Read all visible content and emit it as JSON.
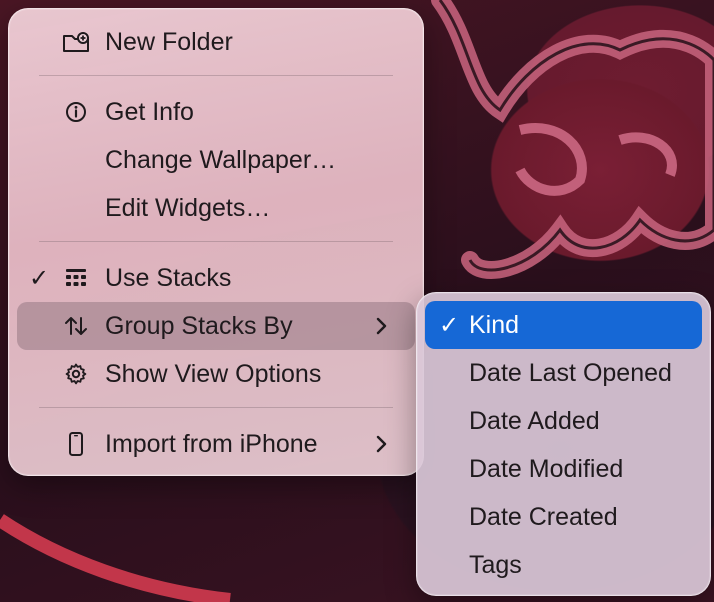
{
  "main_menu": {
    "items": [
      {
        "label": "New Folder",
        "icon": "new-folder-icon"
      },
      {
        "label": "Get Info",
        "icon": "info-icon"
      },
      {
        "label": "Change Wallpaper…"
      },
      {
        "label": "Edit Widgets…"
      },
      {
        "label": "Use Stacks",
        "icon": "stacks-grid-icon",
        "checked": true
      },
      {
        "label": "Group Stacks By",
        "icon": "sort-arrows-icon",
        "has_submenu": true,
        "highlighted": true
      },
      {
        "label": "Show View Options",
        "icon": "gear-icon"
      },
      {
        "label": "Import from iPhone",
        "icon": "iphone-icon",
        "has_submenu": true
      }
    ]
  },
  "sub_menu": {
    "items": [
      {
        "label": "Kind",
        "checked": true,
        "selected": true
      },
      {
        "label": "Date Last Opened"
      },
      {
        "label": "Date Added"
      },
      {
        "label": "Date Modified"
      },
      {
        "label": "Date Created"
      },
      {
        "label": "Tags"
      }
    ]
  },
  "check_glyph": "✓",
  "colors": {
    "selection": "#1668d6",
    "menu_text": "#1f1a1d",
    "highlight": "#96788466"
  }
}
